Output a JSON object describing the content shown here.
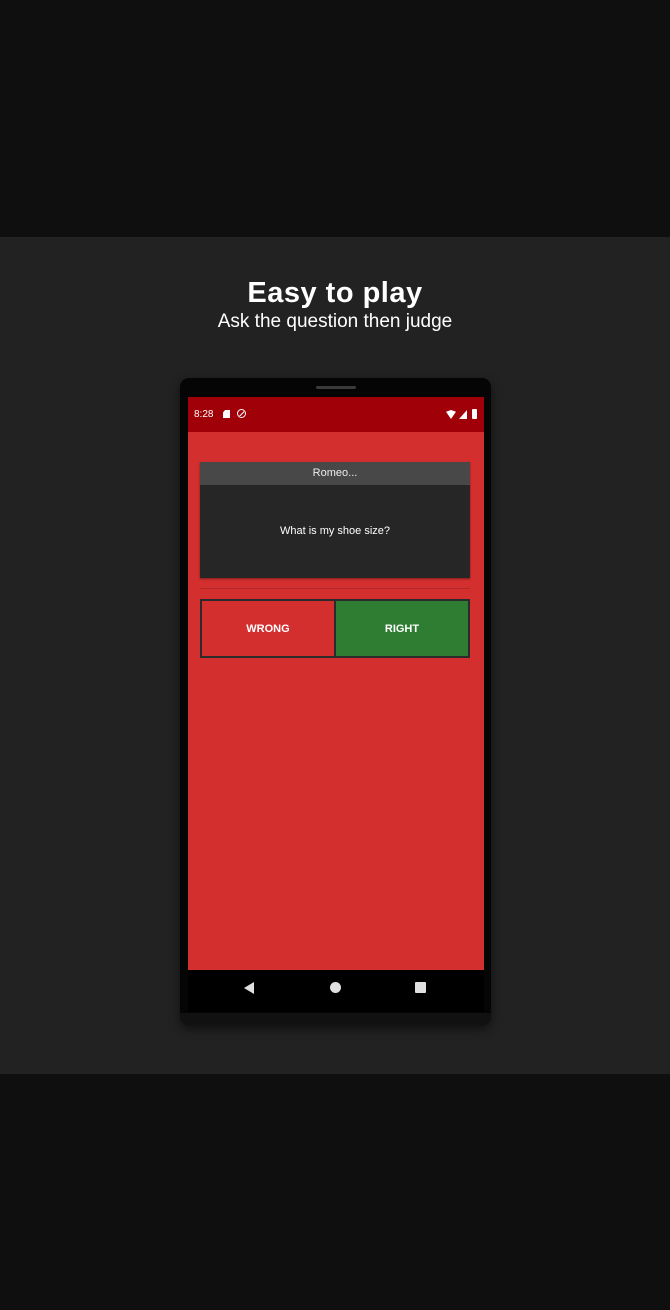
{
  "promo": {
    "headline": "Easy to play",
    "subline": "Ask the question then judge"
  },
  "status_bar": {
    "time": "8:28",
    "icons": [
      "sd-card-icon",
      "sync-icon",
      "wifi-icon",
      "signal-icon",
      "battery-icon"
    ]
  },
  "card": {
    "player": "Romeo...",
    "question": "What is my shoe size?"
  },
  "answer_buttons": {
    "wrong_label": "WRONG",
    "right_label": "RIGHT"
  },
  "nav_bar": {
    "icons": [
      "back-icon",
      "home-icon",
      "recents-icon"
    ]
  },
  "colors": {
    "screen_background": "#d32f2f",
    "status_bar": "#a00008",
    "wrong_button": "#d32f2f",
    "right_button": "#2e7d32",
    "card_header": "#484848",
    "card_body": "#262626"
  }
}
